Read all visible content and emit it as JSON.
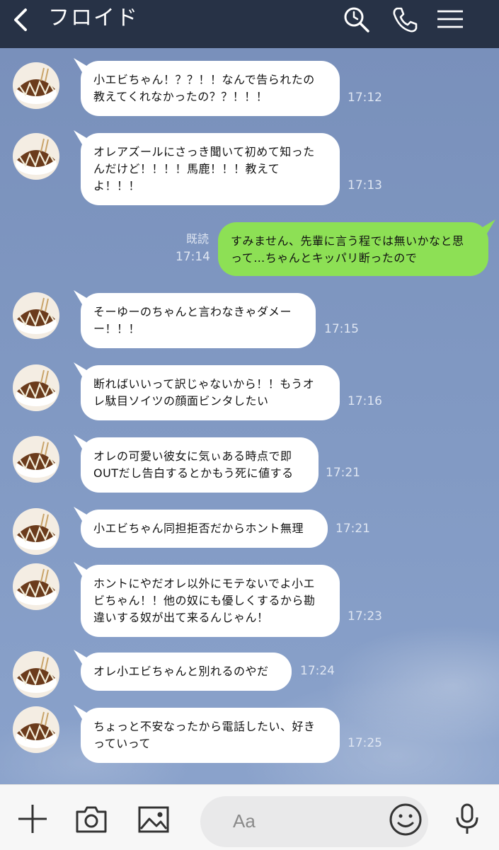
{
  "header": {
    "title": "フロイド",
    "back_icon": "chevron-left-icon",
    "search_icon": "search-icon",
    "call_icon": "phone-icon",
    "menu_icon": "menu-icon"
  },
  "messages": [
    {
      "side": "left",
      "lines": [
        "小エビちゃん！？？！！なんで告られたの",
        "教えてくれなかったの？？！！！"
      ],
      "time": "17:12"
    },
    {
      "side": "left",
      "lines": [
        "オレアズールにさっき聞いて初めて知った",
        "んだけど！！！！馬鹿！！！教えて",
        "よ！！！"
      ],
      "time": "17:13"
    },
    {
      "side": "right",
      "lines": [
        "すみません、先輩に言う程では無いかなと思",
        "って…ちゃんとキッパリ断ったので"
      ],
      "time": "17:14",
      "read": "既読"
    },
    {
      "side": "left",
      "lines": [
        "そーゆーのちゃんと言わなきゃダメー",
        "ー！！！"
      ],
      "time": "17:15"
    },
    {
      "side": "left",
      "lines": [
        "断ればいいって訳じゃないから！！もうオ",
        "レ駄目ソイツの顔面ビンタしたい"
      ],
      "time": "17:16"
    },
    {
      "side": "left",
      "lines": [
        "オレの可愛い彼女に気ぃある時点で即",
        "OUTだし告白するとかもう死に値する"
      ],
      "time": "17:21"
    },
    {
      "side": "left",
      "lines": [
        "小エビちゃん同担拒否だからホント無理"
      ],
      "time": "17:21"
    },
    {
      "side": "left",
      "lines": [
        "ホントにやだオレ以外にモテないでよ小エ",
        "ビちゃん！！他の奴にも優しくするから勘",
        "違いする奴が出て来るんじゃん！"
      ],
      "time": "17:23"
    },
    {
      "side": "left",
      "lines": [
        "オレ小エビちゃんと別れるのやだ"
      ],
      "time": "17:24"
    },
    {
      "side": "left",
      "lines": [
        "ちょっと不安なったから電話したい、好き",
        "っていって"
      ],
      "time": "17:25"
    }
  ],
  "input": {
    "placeholder": "Aa",
    "plus_icon": "plus-icon",
    "camera_icon": "camera-icon",
    "image_icon": "image-icon",
    "emoji_icon": "smile-icon",
    "mic_icon": "mic-icon"
  },
  "colors": {
    "header_bg": "#273246",
    "chat_bg": "#7f97c1",
    "bubble_left": "#ffffff",
    "bubble_right": "#8de055"
  }
}
